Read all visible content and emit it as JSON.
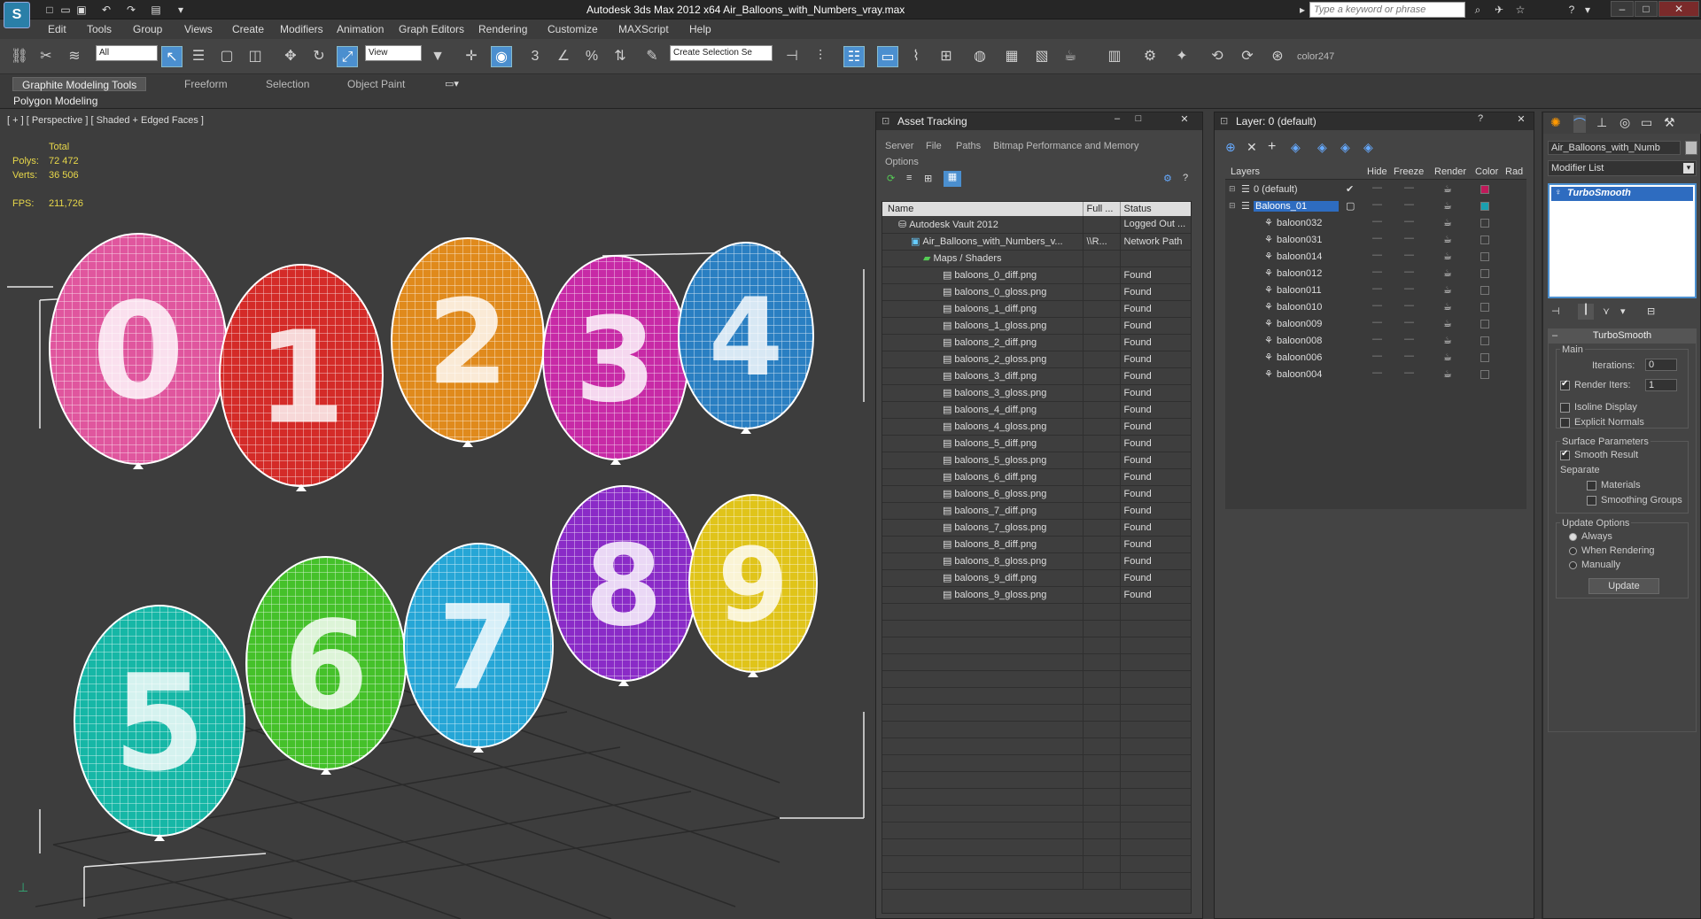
{
  "app": {
    "logo": "S",
    "title": "Autodesk 3ds Max  2012 x64     Air_Balloons_with_Numbers_vray.max",
    "search_placeholder": "Type a keyword or phrase"
  },
  "menu": [
    "Edit",
    "Tools",
    "Group",
    "Views",
    "Create",
    "Modifiers",
    "Animation",
    "Graph Editors",
    "Rendering",
    "Customize",
    "MAXScript",
    "Help"
  ],
  "toolbar": {
    "selection_filter": "All",
    "reference_coord": "View",
    "named_selection": "Create Selection Se",
    "color_label": "color247"
  },
  "ribbon": {
    "tabs": [
      "Graphite Modeling Tools",
      "Freeform",
      "Selection",
      "Object Paint"
    ],
    "sub_label": "Polygon Modeling"
  },
  "viewport": {
    "label": "[ + ] [ Perspective ] [ Shaded + Edged Faces ]",
    "stats": {
      "total_label": "Total",
      "polys_label": "Polys:",
      "polys": "72 472",
      "verts_label": "Verts:",
      "verts": "36 506",
      "fps_label": "FPS:",
      "fps": "211,726"
    },
    "balloons": [
      {
        "num": "0",
        "color": "#e0569e"
      },
      {
        "num": "1",
        "color": "#d42b28"
      },
      {
        "num": "2",
        "color": "#e08a1c"
      },
      {
        "num": "3",
        "color": "#c72aa6"
      },
      {
        "num": "4",
        "color": "#2a7fc2"
      },
      {
        "num": "5",
        "color": "#16b7a6"
      },
      {
        "num": "6",
        "color": "#45c12a"
      },
      {
        "num": "7",
        "color": "#26a6d6"
      },
      {
        "num": "8",
        "color": "#8a2bc7"
      },
      {
        "num": "9",
        "color": "#e0c41a"
      }
    ]
  },
  "asset_tracking": {
    "title": "Asset Tracking",
    "menu": [
      "Server",
      "File",
      "Paths",
      "Bitmap Performance and Memory"
    ],
    "menu2": "Options",
    "columns": [
      "Name",
      "Full ...",
      "Status"
    ],
    "rows": [
      {
        "name": "Autodesk Vault 2012",
        "full": "",
        "status": "Logged Out ..."
      },
      {
        "name": "Air_Balloons_with_Numbers_v...",
        "full": "\\\\R...",
        "status": "Network Path"
      },
      {
        "name": "Maps / Shaders",
        "full": "",
        "status": ""
      },
      {
        "name": "baloons_0_diff.png",
        "full": "",
        "status": "Found"
      },
      {
        "name": "baloons_0_gloss.png",
        "full": "",
        "status": "Found"
      },
      {
        "name": "baloons_1_diff.png",
        "full": "",
        "status": "Found"
      },
      {
        "name": "baloons_1_gloss.png",
        "full": "",
        "status": "Found"
      },
      {
        "name": "baloons_2_diff.png",
        "full": "",
        "status": "Found"
      },
      {
        "name": "baloons_2_gloss.png",
        "full": "",
        "status": "Found"
      },
      {
        "name": "baloons_3_diff.png",
        "full": "",
        "status": "Found"
      },
      {
        "name": "baloons_3_gloss.png",
        "full": "",
        "status": "Found"
      },
      {
        "name": "baloons_4_diff.png",
        "full": "",
        "status": "Found"
      },
      {
        "name": "baloons_4_gloss.png",
        "full": "",
        "status": "Found"
      },
      {
        "name": "baloons_5_diff.png",
        "full": "",
        "status": "Found"
      },
      {
        "name": "baloons_5_gloss.png",
        "full": "",
        "status": "Found"
      },
      {
        "name": "baloons_6_diff.png",
        "full": "",
        "status": "Found"
      },
      {
        "name": "baloons_6_gloss.png",
        "full": "",
        "status": "Found"
      },
      {
        "name": "baloons_7_diff.png",
        "full": "",
        "status": "Found"
      },
      {
        "name": "baloons_7_gloss.png",
        "full": "",
        "status": "Found"
      },
      {
        "name": "baloons_8_diff.png",
        "full": "",
        "status": "Found"
      },
      {
        "name": "baloons_8_gloss.png",
        "full": "",
        "status": "Found"
      },
      {
        "name": "baloons_9_diff.png",
        "full": "",
        "status": "Found"
      },
      {
        "name": "baloons_9_gloss.png",
        "full": "",
        "status": "Found"
      }
    ]
  },
  "layers": {
    "title": "Layer: 0 (default)",
    "columns": [
      "Layers",
      "Hide",
      "Freeze",
      "Render",
      "Color",
      "Rad"
    ],
    "rows": [
      {
        "name": "0 (default)",
        "color": "#c01a5a"
      },
      {
        "name": "Baloons_01",
        "color": "#1aa0b0"
      },
      {
        "name": "baloon032",
        "color": ""
      },
      {
        "name": "baloon031",
        "color": ""
      },
      {
        "name": "baloon014",
        "color": ""
      },
      {
        "name": "baloon012",
        "color": ""
      },
      {
        "name": "baloon011",
        "color": ""
      },
      {
        "name": "baloon010",
        "color": ""
      },
      {
        "name": "baloon009",
        "color": ""
      },
      {
        "name": "baloon008",
        "color": ""
      },
      {
        "name": "baloon006",
        "color": ""
      },
      {
        "name": "baloon004",
        "color": ""
      }
    ]
  },
  "modify": {
    "object_name": "Air_Balloons_with_Numb",
    "modifier_list": "Modifier List",
    "stack_item": "TurboSmooth",
    "rollout_title": "TurboSmooth",
    "main_label": "Main",
    "iterations_label": "Iterations:",
    "iterations": "0",
    "render_iters_label": "Render Iters:",
    "render_iters": "1",
    "isoline": "Isoline Display",
    "explicit": "Explicit Normals",
    "surface_label": "Surface Parameters",
    "smooth_result": "Smooth Result",
    "separate_label": "Separate",
    "materials": "Materials",
    "smoothing_groups": "Smoothing Groups",
    "update_label": "Update Options",
    "always": "Always",
    "when_rendering": "When Rendering",
    "manually": "Manually",
    "update_btn": "Update"
  }
}
